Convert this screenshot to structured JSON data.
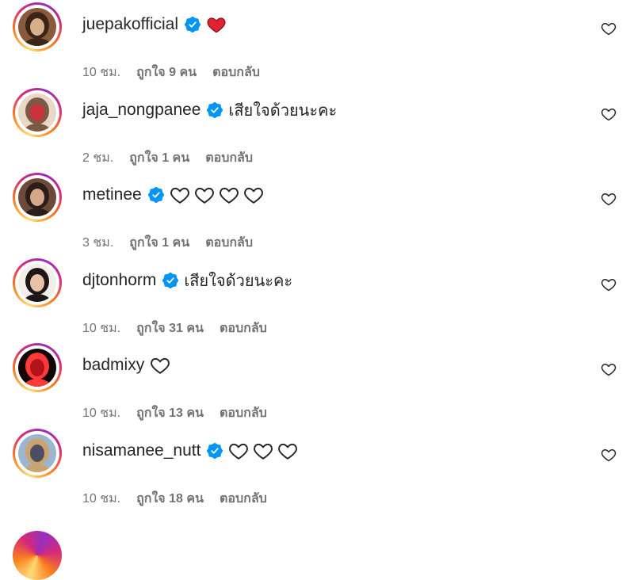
{
  "comments": [
    {
      "username": "juepakofficial",
      "verified": true,
      "text": "",
      "emoji": "red-heart",
      "outline_hearts": 0,
      "time": "10 ชม.",
      "likes": "ถูกใจ 9 คน",
      "reply": "ตอบกลับ",
      "avatar_colors": [
        "#8a5a3c",
        "#d9b08c",
        "#3b2418"
      ]
    },
    {
      "username": "jaja_nongpanee",
      "verified": true,
      "text": "เสียใจด้วยนะคะ",
      "emoji": "",
      "outline_hearts": 0,
      "time": "2 ชม.",
      "likes": "ถูกใจ 1 คน",
      "reply": "ตอบกลับ",
      "avatar_colors": [
        "#e9d8c8",
        "#c8323a",
        "#7b5a44"
      ]
    },
    {
      "username": "metinee",
      "verified": true,
      "text": "",
      "emoji": "",
      "outline_hearts": 4,
      "time": "3 ชม.",
      "likes": "ถูกใจ 1 คน",
      "reply": "ตอบกลับ",
      "avatar_colors": [
        "#6b4a3a",
        "#d6a88a",
        "#2b1d1a"
      ]
    },
    {
      "username": "djtonhorm",
      "verified": true,
      "text": "เสียใจด้วยนะคะ",
      "emoji": "",
      "outline_hearts": 0,
      "time": "10 ชม.",
      "likes": "ถูกใจ 31 คน",
      "reply": "ตอบกลับ",
      "avatar_colors": [
        "#f2eee9",
        "#e8c2a8",
        "#1d1716"
      ]
    },
    {
      "username": "badmixy",
      "verified": false,
      "text": "",
      "emoji": "",
      "outline_hearts": 1,
      "time": "10 ชม.",
      "likes": "ถูกใจ 13 คน",
      "reply": "ตอบกลับ",
      "avatar_colors": [
        "#120606",
        "#b3121b",
        "#ff3a3a"
      ]
    },
    {
      "username": "nisamanee_nutt",
      "verified": true,
      "text": "",
      "emoji": "",
      "outline_hearts": 3,
      "time": "10 ชม.",
      "likes": "ถูกใจ 18 คน",
      "reply": "ตอบกลับ",
      "avatar_colors": [
        "#9db6cf",
        "#4a4f63",
        "#caa36e"
      ]
    }
  ],
  "colors": {
    "verified": "#0095f6",
    "red_heart": "#e0232e",
    "meta_text": "#737373"
  }
}
